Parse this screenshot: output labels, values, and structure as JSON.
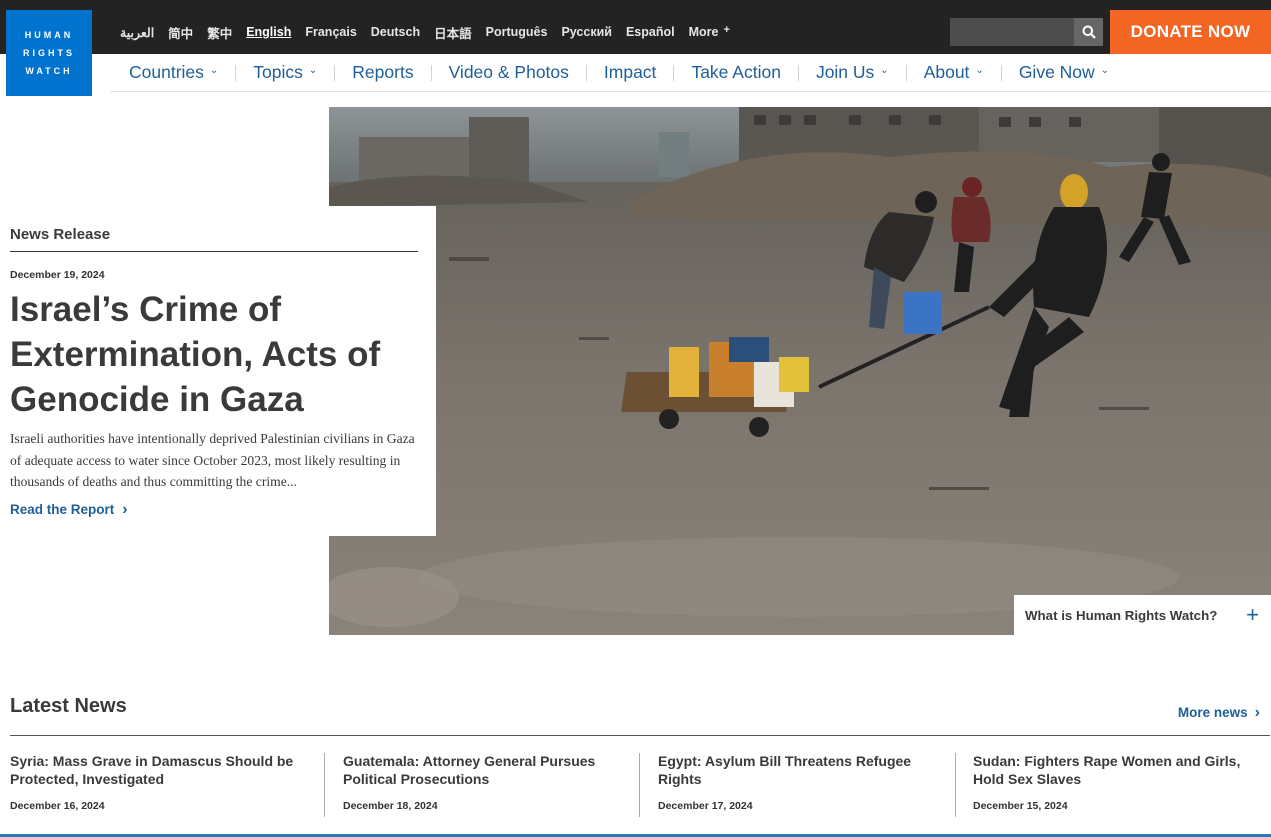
{
  "logo": {
    "lines": [
      "HUMAN",
      "RIGHTS",
      "WATCH"
    ]
  },
  "languages": [
    {
      "label": "العربية"
    },
    {
      "label": "简中"
    },
    {
      "label": "繁中"
    },
    {
      "label": "English",
      "active": true
    },
    {
      "label": "Français"
    },
    {
      "label": "Deutsch"
    },
    {
      "label": "日本語"
    },
    {
      "label": "Português"
    },
    {
      "label": "Русский"
    },
    {
      "label": "Español"
    },
    {
      "label": "More"
    }
  ],
  "search": {
    "placeholder": ""
  },
  "donate_label": "DONATE NOW",
  "nav": [
    {
      "label": "Countries",
      "dropdown": true
    },
    {
      "label": "Topics",
      "dropdown": true
    },
    {
      "label": "Reports",
      "dropdown": false
    },
    {
      "label": "Video & Photos",
      "dropdown": false
    },
    {
      "label": "Impact",
      "dropdown": false
    },
    {
      "label": "Take Action",
      "dropdown": false
    },
    {
      "label": "Join Us",
      "dropdown": true
    },
    {
      "label": "About",
      "dropdown": true
    },
    {
      "label": "Give Now",
      "dropdown": true
    }
  ],
  "hero": {
    "kicker": "News Release",
    "date": "December 19, 2024",
    "title": "Israel’s Crime of Extermination, Acts of Genocide in Gaza",
    "summary": "Israeli authorities have intentionally deprived Palestinian civilians in Gaza of adequate access to water since October 2023, most likely resulting in thousands of deaths and thus committing the crime...",
    "cta": "Read the Report",
    "what_is": "What is Human Rights Watch?"
  },
  "latest_news": {
    "heading": "Latest News",
    "more_label": "More news",
    "items": [
      {
        "title": "Syria: Mass Grave in Damascus Should be Protected, Investigated",
        "date": "December 16, 2024"
      },
      {
        "title": "Guatemala: Attorney General Pursues Political Prosecutions",
        "date": "December 18, 2024"
      },
      {
        "title": "Egypt: Asylum Bill Threatens Refugee Rights",
        "date": "December 17, 2024"
      },
      {
        "title": "Sudan: Fighters Rape Women and Girls, Hold Sex Slaves",
        "date": "December 15, 2024"
      }
    ]
  },
  "colors": {
    "brand_blue": "#0073cf",
    "donate_orange": "#f26522",
    "link_blue": "#1f5f99",
    "topbar": "#232323"
  }
}
